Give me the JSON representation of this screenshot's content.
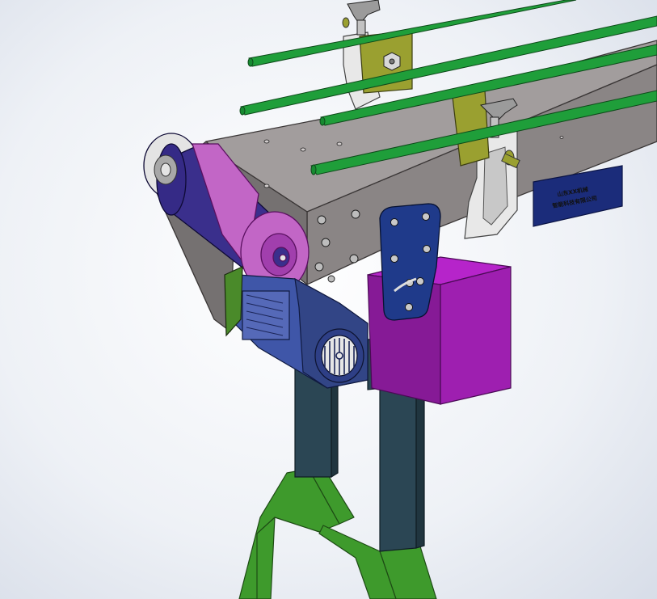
{
  "colors": {
    "background": "#eef1f6",
    "guide_rail": "#1f9e3a",
    "frame": "#8a8585",
    "frame_top": "#a29d9d",
    "roller_belt": "#3a2f8c",
    "pulley": "#c266c6",
    "motor": "#3f56a8",
    "side_plate": "#1f3a8a",
    "control_box": "#9e1fb0",
    "leg": "#2b4654",
    "base": "#3e9a2c",
    "bracket": "#e8e8e8",
    "clamp": "#9aa030",
    "nameplate": "#1b2c7a"
  },
  "nameplate": {
    "line1": "山东XX机械",
    "line2": "智能科技有限公司"
  },
  "parts": [
    "guide-rail",
    "rail-bracket",
    "clamp-knob",
    "conveyor-frame",
    "drive-roller",
    "motor",
    "side-plate",
    "control-box",
    "leg",
    "leg-base",
    "nameplate"
  ]
}
